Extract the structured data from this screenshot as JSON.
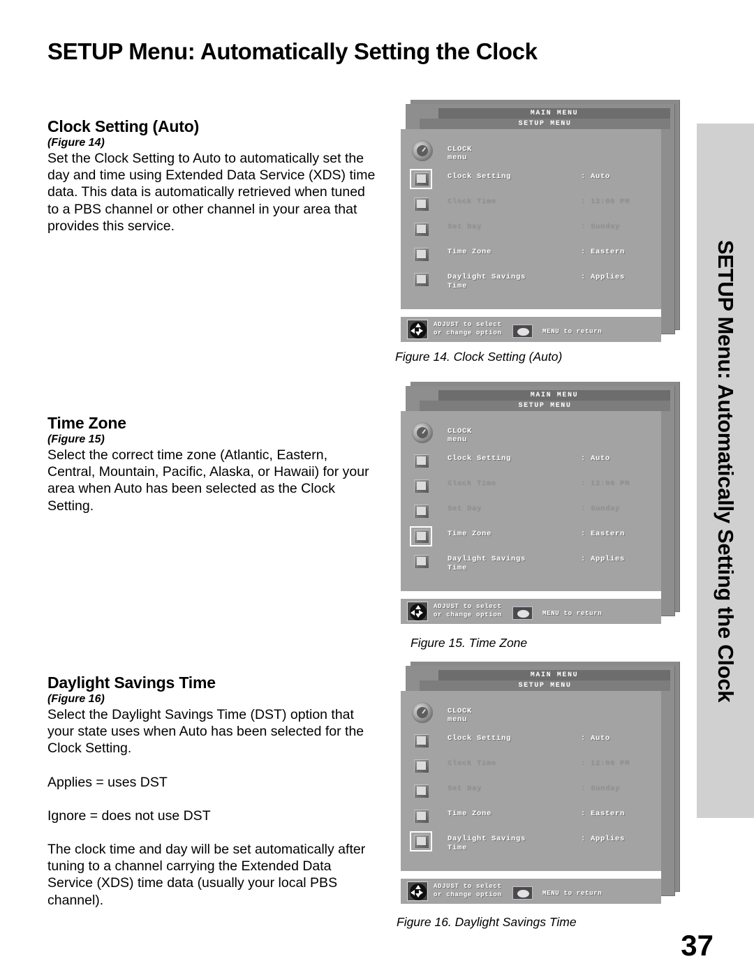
{
  "page": {
    "title": "SETUP Menu: Automatically Setting the Clock",
    "side_tab_text": "SETUP Menu: Automatically Setting the Clock",
    "page_number": "37"
  },
  "sections": [
    {
      "heading": "Clock Setting (Auto)",
      "figure_ref": "(Figure 14)",
      "paragraphs": [
        "Set the Clock Setting to Auto to automatically set the day and time using Extended Data Service (XDS) time data.  This data is automatically retrieved when tuned to a PBS channel or other channel in your area that provides this service."
      ]
    },
    {
      "heading": "Time Zone",
      "figure_ref": "(Figure 15)",
      "paragraphs": [
        "Select the correct time zone (Atlantic, Eastern, Central, Mountain, Pacific, Alaska, or Hawaii) for your area when Auto has been selected as the Clock Setting."
      ]
    },
    {
      "heading": "Daylight Savings Time",
      "figure_ref": "(Figure 16)",
      "paragraphs": [
        "Select the Daylight Savings Time (DST) option that your state uses when Auto has been selected for the Clock Setting.",
        "Applies = uses DST",
        "Ignore = does not use DST",
        "The clock time and day will be set automatically after tuning to a channel carrying the Extended Data Service (XDS) time data (usually your local PBS channel)."
      ]
    }
  ],
  "osd": {
    "title_main": "MAIN MENU",
    "title_setup": "SETUP MENU",
    "clock_menu_label": "CLOCK menu",
    "colon": ":",
    "footer": {
      "adjust_line1": "ADJUST to select",
      "adjust_line2": "or change option",
      "menu_return": "MENU to return"
    },
    "rows": [
      {
        "label": "Clock Setting",
        "value": "Auto",
        "dim": false
      },
      {
        "label": "Clock Time",
        "value": "12:00 PM",
        "dim": true
      },
      {
        "label": "Set Day",
        "value": "Sunday",
        "dim": true
      },
      {
        "label": "Time Zone",
        "value": "Eastern",
        "dim": false
      },
      {
        "label": "Daylight Savings\nTime",
        "value": "Applies",
        "dim": false
      }
    ]
  },
  "figures": [
    {
      "caption": "Figure 14.  Clock Setting (Auto)",
      "selected_index": 0
    },
    {
      "caption": "Figure 15.  Time Zone",
      "selected_index": 3
    },
    {
      "caption": "Figure 16.  Daylight Savings Time",
      "selected_index": 4
    }
  ],
  "colors": {
    "osd_panel": "#a3a3a3",
    "osd_title_main": "#6d6d6d",
    "osd_title_setup": "#7d7d7d",
    "side_tab": "#d0d0d0",
    "text": "#000000"
  }
}
